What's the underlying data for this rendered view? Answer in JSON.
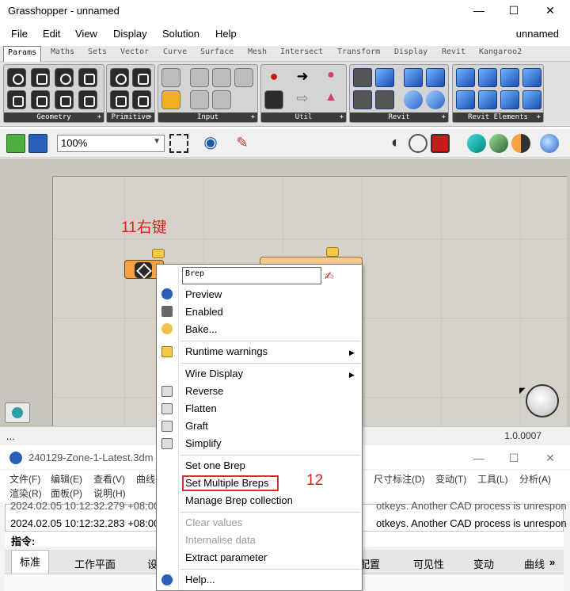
{
  "window": {
    "title": "Grasshopper - unnamed",
    "minimize": "—",
    "maximize": "☐",
    "close": "✕"
  },
  "menu": {
    "items": [
      "File",
      "Edit",
      "View",
      "Display",
      "Solution",
      "Help"
    ],
    "document": "unnamed"
  },
  "tabs": [
    "Params",
    "Maths",
    "Sets",
    "Vector",
    "Curve",
    "Surface",
    "Mesh",
    "Intersect",
    "Transform",
    "Display",
    "Revit",
    "Kangaroo2"
  ],
  "ribbon_groups": [
    "Geometry",
    "Primitive",
    "Input",
    "Util",
    "Revit",
    "Revit Elements"
  ],
  "canvas_toolbar": {
    "zoom": "100%"
  },
  "annotations": {
    "right_click": "11右键",
    "step": "12"
  },
  "status": {
    "left": "...",
    "version": "1.0.0007"
  },
  "context_menu": {
    "name_value": "Brep",
    "items": [
      {
        "label": "Preview",
        "icon": "preview-icon"
      },
      {
        "label": "Enabled",
        "icon": "enabled-icon"
      },
      {
        "label": "Bake...",
        "icon": "bake-icon"
      },
      {
        "label": "Runtime warnings",
        "icon": "warning-icon"
      },
      {
        "label": "Wire Display",
        "icon": ""
      },
      {
        "label": "Reverse",
        "icon": "reverse-icon"
      },
      {
        "label": "Flatten",
        "icon": "flatten-icon"
      },
      {
        "label": "Graft",
        "icon": "graft-icon"
      },
      {
        "label": "Simplify",
        "icon": "simplify-icon"
      },
      {
        "label": "Set one Brep",
        "icon": ""
      },
      {
        "label": "Set Multiple Breps",
        "icon": ""
      },
      {
        "label": "Manage Brep collection",
        "icon": ""
      },
      {
        "label": "Clear values",
        "icon": ""
      },
      {
        "label": "Internalise data",
        "icon": ""
      },
      {
        "label": "Extract parameter",
        "icon": ""
      },
      {
        "label": "Help...",
        "icon": "help-icon"
      }
    ]
  },
  "rhino": {
    "title": "240129-Zone-1-Latest.3dm (44",
    "menu": [
      "文件(F)",
      "编辑(E)",
      "查看(V)",
      "曲线",
      "尺寸标注(D)",
      "变动(T)",
      "工具(L)",
      "分析(A)"
    ],
    "menu2": [
      "渲染(R)",
      "面板(P)",
      "说明(H)"
    ],
    "log_line1_left": "2024.02.05 10:12:32.279 +08:00",
    "log_line1_right": "otkeys. Another CAD process is unrespon",
    "log_line2_left": "2024.02.05 10:12:32.283 +08:00",
    "log_line2_right": "otkeys. Another CAD process is unrespon",
    "command": "指令:",
    "tabs": [
      "标准",
      "工作平面",
      "设",
      "配置",
      "可见性",
      "变动",
      "曲线"
    ],
    "more": "»"
  }
}
